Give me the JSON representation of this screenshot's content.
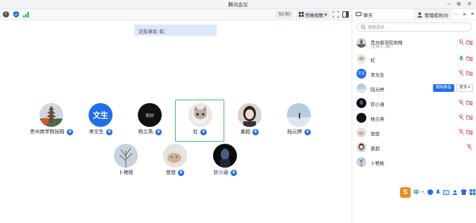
{
  "window": {
    "title": "腾讯会议",
    "minimize": "–",
    "restore": "⧉",
    "close": "✕"
  },
  "toolbar": {
    "timer": "51:50",
    "view_label": "宫格视图",
    "view_caret": "▾"
  },
  "speaking": {
    "text": "正在讲话: 虹;"
  },
  "tiles": [
    {
      "name": "贵州商学院张翔",
      "mic": true
    },
    {
      "name": "李文生",
      "mic": true,
      "avatar_text": "文生"
    },
    {
      "name": "杨兰燕",
      "mic": true,
      "avatar_text": "你好"
    },
    {
      "name": "虹",
      "mic": true
    },
    {
      "name": "姜超",
      "mic": true
    },
    {
      "name": "陆元婷",
      "mic": true
    },
    {
      "name": "卜艳桃",
      "mic": false
    },
    {
      "name": "悠悠",
      "mic": true
    },
    {
      "name": "钦小涵",
      "mic": true
    }
  ],
  "panel": {
    "tab_chat": "聊天",
    "tab_members": "管理成员(9)",
    "more": "···",
    "close": "×",
    "search_placeholder": "搜索成员",
    "members": [
      {
        "name": "贵州商学院张翔",
        "sub": "(主持人, 我)"
      },
      {
        "name": "虹",
        "sub": ""
      },
      {
        "name": "李文生",
        "sub": "",
        "avatar_text": "文生"
      },
      {
        "name": "陆元婷",
        "sub": ""
      },
      {
        "name": "钦小涵",
        "sub": ""
      },
      {
        "name": "杨兰燕",
        "sub": ""
      },
      {
        "name": "悠悠",
        "sub": ""
      },
      {
        "name": "姜超",
        "sub": ""
      },
      {
        "name": "卜艳桃",
        "sub": ""
      }
    ],
    "unmute_label": "解除静音",
    "more_label": "更多 ▾"
  },
  "ime": {
    "logo": "S",
    "lang": "中"
  },
  "colors": {
    "accent": "#1e6fe8",
    "active_border": "#37c46b",
    "mic_on": "#2bb24c",
    "mic_off": "#e05a5a"
  }
}
